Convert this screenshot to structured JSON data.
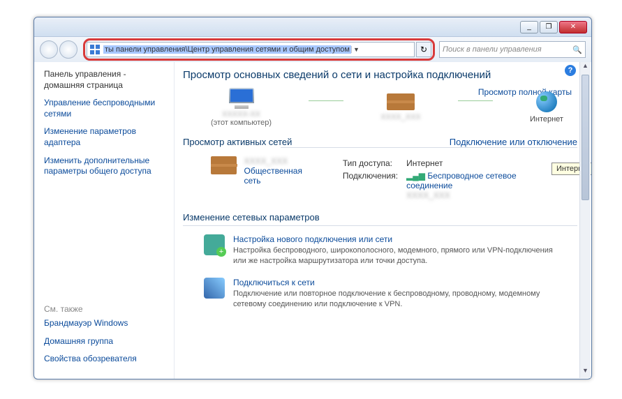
{
  "titlebar": {
    "min": "_",
    "max": "❐",
    "close": "✕"
  },
  "toolbar": {
    "address": "ты панели управления\\Центр управления сетями и общим доступом",
    "search_placeholder": "Поиск в панели управления"
  },
  "sidebar": {
    "home": "Панель управления - домашняя страница",
    "links": [
      "Управление беспроводными сетями",
      "Изменение параметров адаптера",
      "Изменить дополнительные параметры общего доступа"
    ],
    "see_also_head": "См. также",
    "see_also": [
      "Брандмауэр Windows",
      "Домашняя группа",
      "Свойства обозревателя"
    ]
  },
  "content": {
    "heading": "Просмотр основных сведений о сети и настройка подключений",
    "full_map": "Просмотр полной карты",
    "map": {
      "this_pc_sub": "(этот компьютер)",
      "internet": "Интернет"
    },
    "tooltip": "Интернет",
    "active_head": "Просмотр активных сетей",
    "connect_link": "Подключение или отключение",
    "net_type": "Общественная сеть",
    "access_lbl": "Тип доступа:",
    "access_val": "Интернет",
    "conn_lbl": "Подключения:",
    "conn_val": "Беспроводное сетевое соединение",
    "settings_head": "Изменение сетевых параметров",
    "items": [
      {
        "title": "Настройка нового подключения или сети",
        "desc": "Настройка беспроводного, широкополосного, модемного, прямого или VPN-подключения или же настройка маршрутизатора или точки доступа."
      },
      {
        "title": "Подключиться к сети",
        "desc": "Подключение или повторное подключение к беспроводному, проводному, модемному сетевому соединению или подключение к VPN."
      }
    ]
  }
}
